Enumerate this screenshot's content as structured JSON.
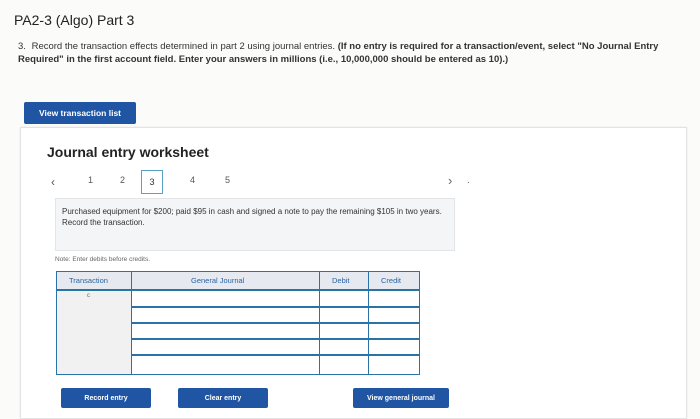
{
  "page": {
    "title": "PA2-3 (Algo) Part 3",
    "question_number": "3.",
    "question_text": "Record the transaction effects determined in part 2 using journal entries.",
    "question_bold": "(If no entry is required for a transaction/event, select \"No Journal Entry Required\" in the first account field. Enter your answers in millions (i.e., 10,000,000 should be entered as 10).)"
  },
  "buttons": {
    "view_transaction_list": "View transaction list",
    "record_entry": "Record entry",
    "clear_entry": "Clear entry",
    "view_general_journal": "View general journal"
  },
  "worksheet": {
    "title": "Journal entry worksheet",
    "steps": [
      "1",
      "2",
      "3",
      "4",
      "5"
    ],
    "active_step": "3",
    "description": "Purchased equipment for $200; paid $95 in cash and signed a note to pay the remaining $105 in two years. Record the transaction.",
    "note": "Note: Enter debits before credits.",
    "next_dot": "."
  },
  "journal": {
    "headers": {
      "transaction": "Transaction",
      "general_journal": "General Journal",
      "debit": "Debit",
      "credit": "Credit"
    },
    "transaction_value": "c",
    "rows": 5
  },
  "colors": {
    "button_blue": "#1f55a3",
    "table_border": "#2a73a6",
    "header_text": "#2864a0"
  }
}
